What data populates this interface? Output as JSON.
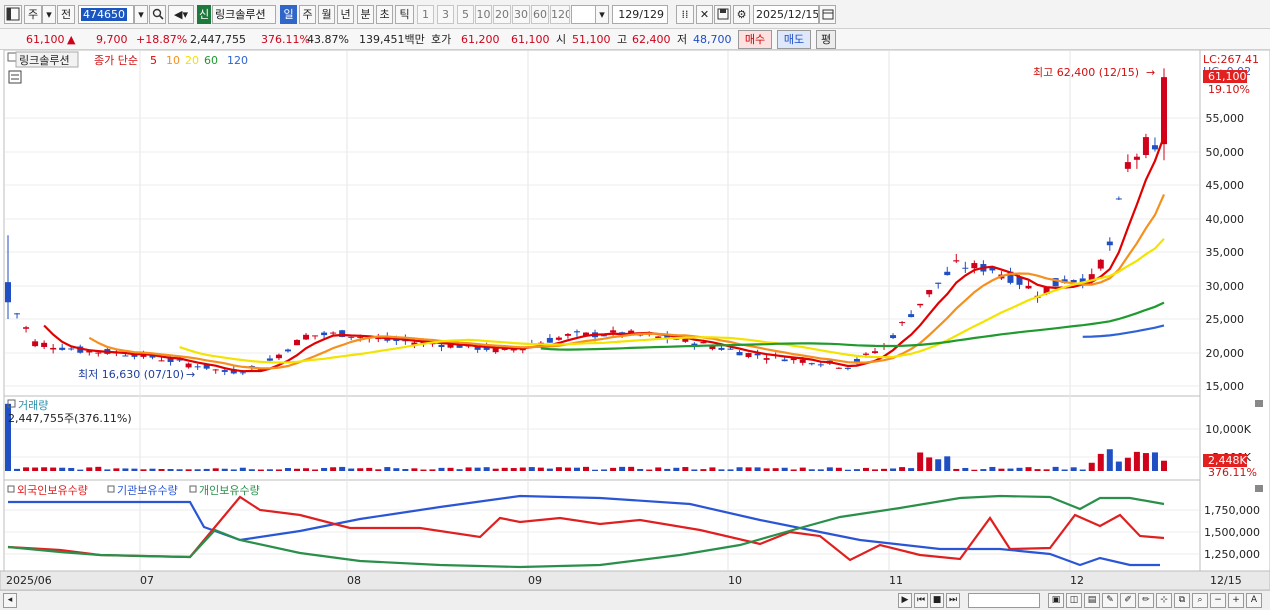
{
  "toolbar": {
    "kind": "주",
    "prev": "전",
    "code": "474650",
    "new_badge": "신",
    "stock_name": "링크솔루션",
    "period_day": "일",
    "period_week": "주",
    "period_month": "월",
    "period_year": "년",
    "period_min": "분",
    "period_sec": "초",
    "period_tick": "틱",
    "tick_values": [
      "1",
      "3",
      "5",
      "10",
      "20",
      "30",
      "60",
      "120"
    ],
    "count": "129/129",
    "date": "2025/12/15"
  },
  "quote": {
    "price": "61,100",
    "change": "9,700",
    "change_pct": "+18.87%",
    "volume": "2,447,755",
    "volume_ratio": "376.11%",
    "turnover": "43.87%",
    "amount": "139,451백만",
    "ask_label": "호가",
    "ask": "61,200",
    "bid": "61,100",
    "open_label": "시",
    "open": "51,100",
    "high_label": "고",
    "high": "62,400",
    "low_label": "저",
    "low": "48,700",
    "buy": "매수",
    "sell": "매도",
    "avg": "평"
  },
  "price_pane": {
    "legend_name": "링크솔루션",
    "legend_type": "종가 단순",
    "ma": [
      {
        "label": "5",
        "color": "#e10000"
      },
      {
        "label": "10",
        "color": "#f5901e"
      },
      {
        "label": "20",
        "color": "#f2e400"
      },
      {
        "label": "60",
        "color": "#1f9a2e"
      },
      {
        "label": "120",
        "color": "#2e63d6"
      }
    ],
    "lc": "LC:267.41",
    "hc": "HC:-0.02",
    "last_price": "61,100",
    "last_pct": "19.10%",
    "high_note": "최고 62,400 (12/15)",
    "low_note": "최저 16,630 (07/10)",
    "y_labels": [
      "55,000",
      "50,000",
      "45,000",
      "40,000",
      "35,000",
      "30,000",
      "25,000",
      "20,000",
      "15,000"
    ]
  },
  "volume_pane": {
    "title": "거래량",
    "value": "2,447,755주(376.11%)",
    "y_labels": [
      "10,000K",
      "5,000K"
    ],
    "last_value": "2,448K",
    "last_pct": "376.11%"
  },
  "holding_pane": {
    "legend": [
      {
        "label": "외국인보유수량",
        "color": "#e02020"
      },
      {
        "label": "기관보유수량",
        "color": "#2a56d6"
      },
      {
        "label": "개인보유수량",
        "color": "#2a8f4a"
      }
    ],
    "y_labels": [
      "1,750,000",
      "1,500,000",
      "1,250,000"
    ]
  },
  "x_axis": [
    "2025/06",
    "07",
    "08",
    "09",
    "10",
    "11",
    "12",
    "12/15"
  ],
  "colors": {
    "up": "#d0021b",
    "down": "#1f4fc3",
    "grid": "#e3e3e3"
  }
}
